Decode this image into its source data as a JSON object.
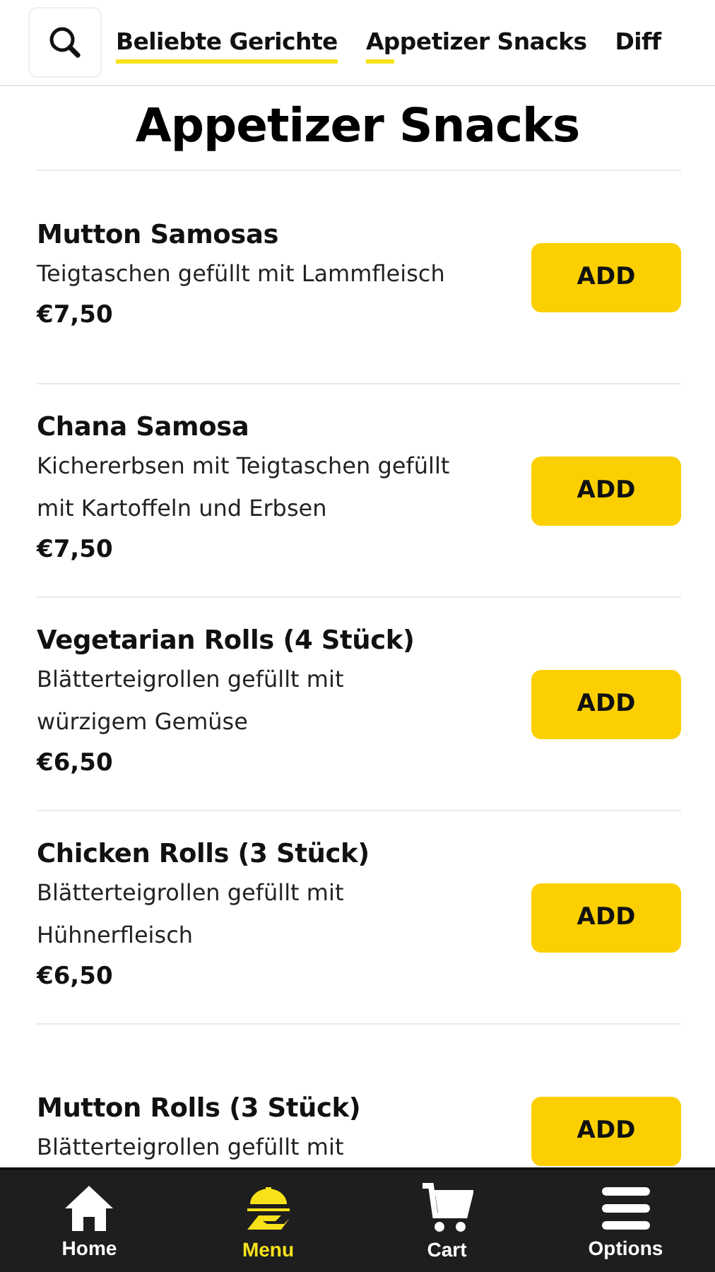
{
  "tabs": [
    {
      "label": "Beliebte Gerichte",
      "level": 1
    },
    {
      "label": "Appetizer Snacks",
      "level": 0.13
    },
    {
      "label": "Diff"
    }
  ],
  "section_title": "Appetizer Snacks",
  "items": [
    {
      "name": "Mutton Samosas",
      "description": "Teigtaschen gefüllt mit Lammfleisch",
      "price": "€7,50",
      "button": "ADD"
    },
    {
      "name": "Chana Samosa",
      "description": "Kichererbsen mit Teigtaschen gefüllt mit Kartoffeln und Erbsen",
      "price": "€7,50",
      "button": "ADD"
    },
    {
      "name": "Vegetarian Rolls (4 Stück)",
      "description": "Blätterteigrollen gefüllt mit würzigem Gemüse",
      "price": "€6,50",
      "button": "ADD"
    },
    {
      "name": "Chicken Rolls (3 Stück)",
      "description": "Blätterteigrollen gefüllt mit Hühnerfleisch",
      "price": "€6,50",
      "button": "ADD"
    },
    {
      "name": "Mutton Rolls (3 Stück)",
      "description": "Blätterteigrollen gefüllt mit",
      "button": "ADD"
    }
  ],
  "nav": [
    {
      "kind": "home",
      "label": "Home",
      "selected": false
    },
    {
      "kind": "menu",
      "label": "Menu",
      "selected": true
    },
    {
      "kind": "cart",
      "label": "Cart",
      "selected": false
    },
    {
      "kind": "options",
      "label": "Options",
      "selected": false
    }
  ]
}
